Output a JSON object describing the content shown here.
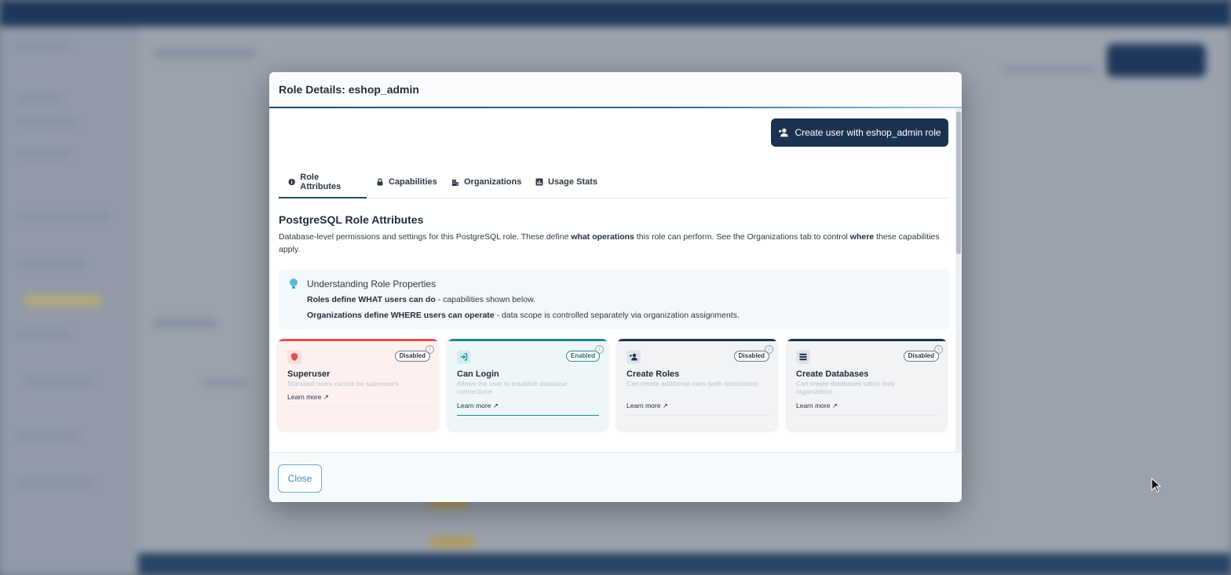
{
  "modal": {
    "title": "Role Details: eshop_admin",
    "create_button_label": "Create user with eshop_admin role",
    "tabs": [
      {
        "label": "Role Attributes",
        "icon": "info-icon"
      },
      {
        "label": "Capabilities",
        "icon": "lock-icon"
      },
      {
        "label": "Organizations",
        "icon": "building-icon"
      },
      {
        "label": "Usage Stats",
        "icon": "chart-icon"
      }
    ],
    "active_tab": "Role Attributes",
    "section_title": "PostgreSQL Role Attributes",
    "section_desc": {
      "part1": "Database-level permissions and settings for this PostgreSQL role. These define ",
      "bold1": "what operations",
      "part2": " this role can perform. See the Organizations tab to control ",
      "bold2": "where",
      "part3": " these capabilities apply."
    },
    "info": {
      "title": "Understanding Role Properties",
      "line1_bold": "Roles define WHAT users can do",
      "line1_rest": " - capabilities shown below.",
      "line2_bold": "Organizations define WHERE users can operate",
      "line2_rest": " - data scope is controlled separately via organization assignments."
    },
    "cards": [
      {
        "title": "Superuser",
        "status": "Disabled",
        "description": "Standard users cannot be superusers",
        "learn_more": "Learn more",
        "accent": "#e0504a",
        "tint": "#fdf1f0",
        "icon": "shield-icon"
      },
      {
        "title": "Can Login",
        "status": "Enabled",
        "description": "Allows the user to establish database connections",
        "learn_more": "Learn more",
        "accent": "#1f8a8a",
        "tint": "#eef7f7",
        "icon": "login-icon"
      },
      {
        "title": "Create Roles",
        "status": "Disabled",
        "description": "Can create additional roles (with restrictions)",
        "learn_more": "Learn more",
        "accent": "#1b3352",
        "tint": "#f1f3f5",
        "icon": "add-user-icon"
      },
      {
        "title": "Create Databases",
        "status": "Disabled",
        "description": "Can create databases within their organization",
        "learn_more": "Learn more",
        "accent": "#1b3352",
        "tint": "#f1f3f5",
        "icon": "database-icon"
      }
    ],
    "next_row_accents": [
      "#f0a23a",
      "#e0504a",
      "#3aaed8",
      "#3aaed8"
    ],
    "close_label": "Close"
  },
  "colors": {
    "primary": "#1b3352",
    "accent": "#1f4b6a",
    "link": "#3a8cc2"
  }
}
